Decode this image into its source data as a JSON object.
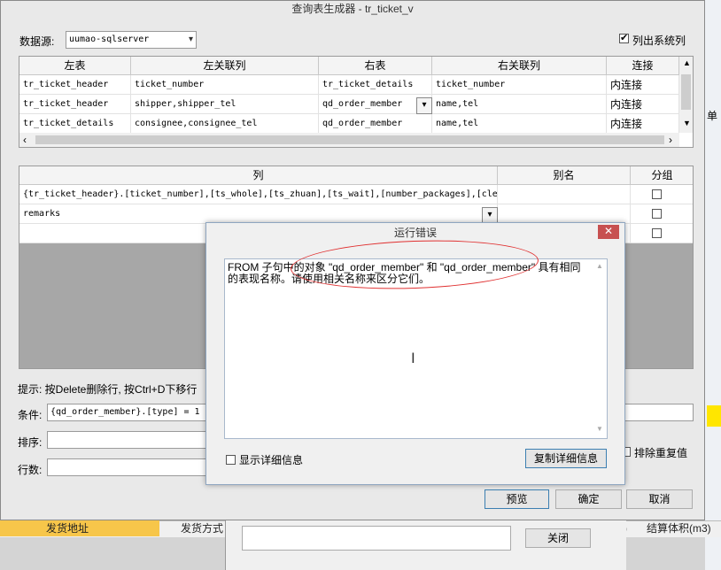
{
  "window": {
    "title": "查询表生成器 - tr_ticket_v"
  },
  "datasource": {
    "label": "数据源:",
    "value": "uumao-sqlserver"
  },
  "list_system": {
    "label": "列出系统列",
    "checked": true
  },
  "join_table": {
    "headers": [
      "左表",
      "左关联列",
      "右表",
      "右关联列",
      "连接"
    ],
    "rows": [
      [
        "tr_ticket_header",
        "ticket_number",
        "tr_ticket_details",
        "ticket_number",
        "内连接"
      ],
      [
        "tr_ticket_header",
        "shipper,shipper_tel",
        "qd_order_member",
        "name,tel",
        "内连接"
      ],
      [
        "tr_ticket_details",
        "consignee,consignee_tel",
        "qd_order_member",
        "name,tel",
        "内连接"
      ]
    ]
  },
  "column_table": {
    "headers": [
      "列",
      "别名",
      "分组"
    ],
    "rows": [
      [
        "{tr_ticket_header}.[ticket_number],[ts_whole],[ts_zhuan],[ts_wait],[number_packages],[cle",
        "",
        ""
      ],
      [
        "remarks",
        "",
        ""
      ],
      [
        "",
        "",
        ""
      ]
    ]
  },
  "hint": {
    "text": "提示: 按Delete删除行, 按Ctrl+D下移行"
  },
  "condition": {
    "label": "条件:",
    "value": "{qd_order_member}.[type] = 1"
  },
  "sort": {
    "label": "排序:",
    "value": ""
  },
  "rows_count": {
    "label": "行数:",
    "value": ""
  },
  "dedupe": {
    "label": "排除重复值"
  },
  "buttons": {
    "preview": "预览",
    "ok": "确定",
    "cancel": "取消"
  },
  "error_dialog": {
    "title": "运行错误",
    "close": "✕",
    "message": "FROM 子句中的对象 \"qd_order_member\" 和 \"qd_order_member\" 具有相同的表现名称。请使用相关名称来区分它们。",
    "show_details": "显示详细信息",
    "copy_details": "复制详细信息"
  },
  "background": {
    "cells": [
      "发货地址",
      "发货方式",
      "(㎡)",
      "结算体积(m3)"
    ],
    "side_label": "单",
    "close_button": "关闭"
  },
  "icons": [
    "dropdown-arrow-icon",
    "close-icon",
    "text-cursor-icon",
    "checkbox-icon"
  ]
}
